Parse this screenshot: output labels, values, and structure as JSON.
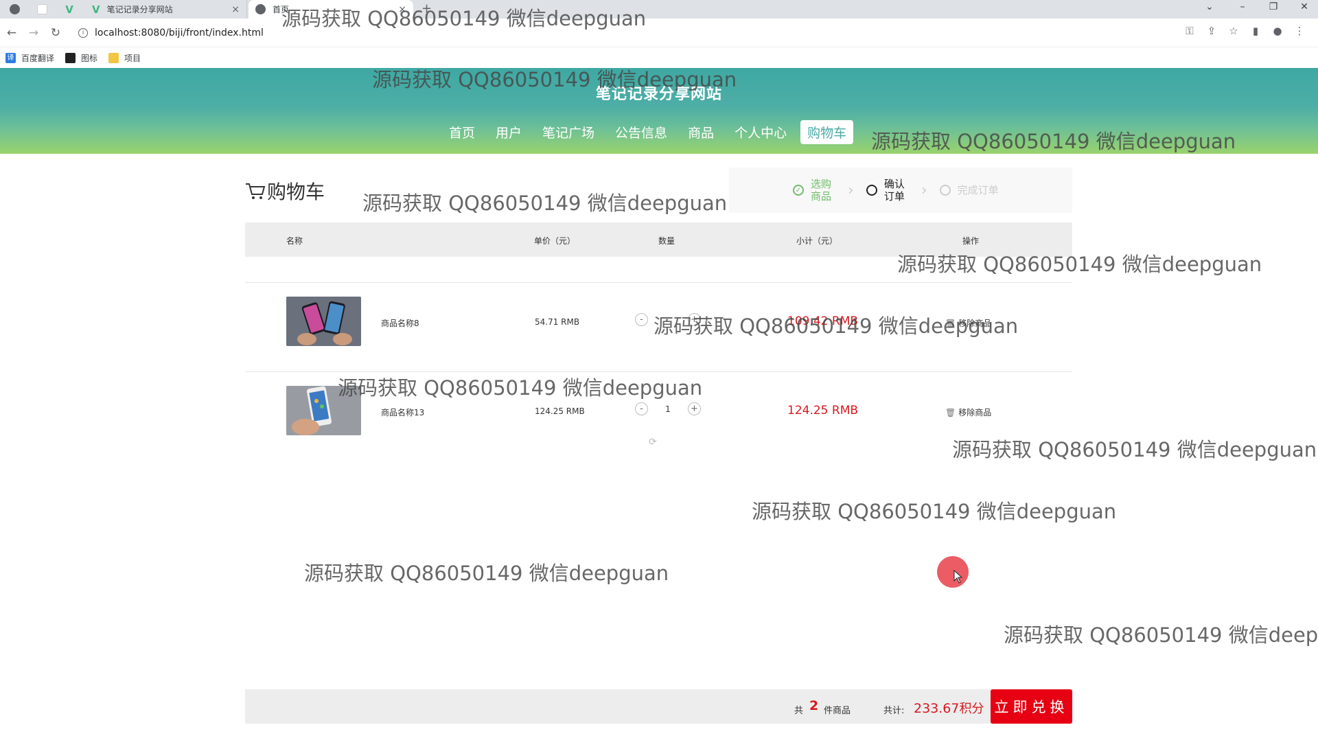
{
  "browser": {
    "tabs": [
      {
        "title": "笔记记录分享网站"
      },
      {
        "title": "首页"
      }
    ],
    "url": "localhost:8080/biji/front/index.html",
    "bookmarks": [
      "百度翻译",
      "图标",
      "项目"
    ],
    "window_controls": {
      "dropdown": "⌄",
      "minimize": "–",
      "restore": "❐",
      "close": "✕"
    },
    "new_tab": "+",
    "tab_close": "×"
  },
  "site": {
    "title": "笔记记录分享网站",
    "nav": [
      {
        "label": "首页",
        "active": false
      },
      {
        "label": "用户",
        "active": false
      },
      {
        "label": "笔记广场",
        "active": false
      },
      {
        "label": "公告信息",
        "active": false
      },
      {
        "label": "商品",
        "active": false
      },
      {
        "label": "个人中心",
        "active": false
      },
      {
        "label": "购物车",
        "active": true
      }
    ],
    "active_color": "#4aaaa6"
  },
  "cart": {
    "title": "购物车",
    "steps": [
      {
        "label": "选购商品",
        "state": "done"
      },
      {
        "label": "确认订单",
        "state": "current"
      },
      {
        "label": "完成订单",
        "state": "todo"
      }
    ],
    "columns": {
      "name": "名称",
      "price": "单价（元）",
      "qty": "数量",
      "subtotal": "小计（元）",
      "action": "操作"
    },
    "items": [
      {
        "name": "商品名称8",
        "price": "54.71 RMB",
        "qty": "",
        "subtotal": "109.42 RMB",
        "remove": "移除商品",
        "decrement": "-",
        "increment": "+"
      },
      {
        "name": "商品名称13",
        "price": "124.25 RMB",
        "qty": "1",
        "subtotal": "124.25 RMB",
        "remove": "移除商品",
        "decrement": "-",
        "increment": "+"
      }
    ],
    "summary": {
      "count_prefix": "共",
      "count": "2",
      "count_suffix": "件商品",
      "total_label": "共计:",
      "total_value": "233.67",
      "total_unit": "积分",
      "submit_label": "立即兑换"
    },
    "accent_color": "#d7191f"
  },
  "watermark": {
    "text": "源码获取 QQ86050149 微信deepguan",
    "text_cut": "源码获取 QQ86050149 微信deep"
  }
}
